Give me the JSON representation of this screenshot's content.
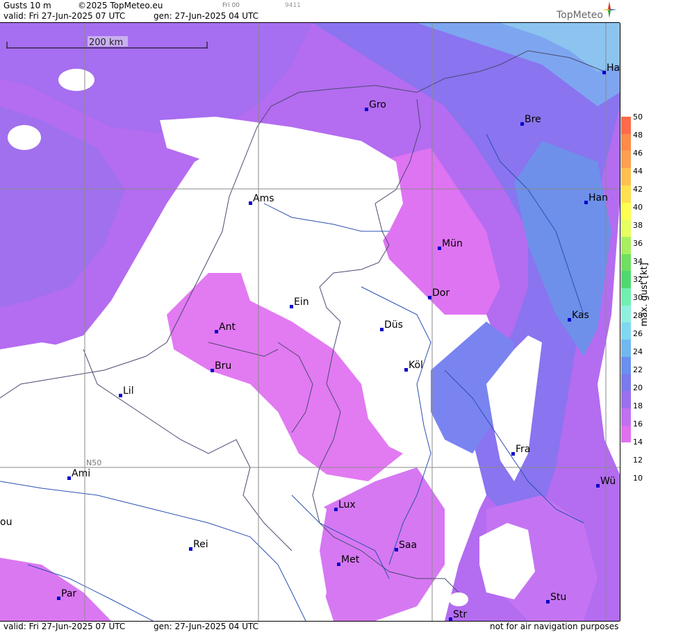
{
  "header": {
    "product": "Gusts 10 m",
    "copyright": "©2025 TopMeteo.eu",
    "frame_label": "Fri 00",
    "frame_code": "9411",
    "valid": "valid:  Fri  27-Jun-2025  07 UTC",
    "gen": "gen:  27-Jun-2025  04 UTC",
    "brand": "TopMeteo"
  },
  "footer": {
    "valid": "valid:  Fri  27-Jun-2025  07 UTC",
    "gen": "gen:  27-Jun-2025  04 UTC",
    "disclaimer": "not for air navigation purposes"
  },
  "scale_bar": {
    "label": "200 km"
  },
  "grid_label": "N50",
  "cities": [
    {
      "name": "Gro"
    },
    {
      "name": "Bre"
    },
    {
      "name": "Ha"
    },
    {
      "name": "Ams"
    },
    {
      "name": "Han"
    },
    {
      "name": "Mün"
    },
    {
      "name": "Dor"
    },
    {
      "name": "Ein"
    },
    {
      "name": "Kas"
    },
    {
      "name": "Ant"
    },
    {
      "name": "Düs"
    },
    {
      "name": "Köl"
    },
    {
      "name": "Bru"
    },
    {
      "name": "Lil"
    },
    {
      "name": "Fra"
    },
    {
      "name": "Ami"
    },
    {
      "name": "Wü"
    },
    {
      "name": "Lux"
    },
    {
      "name": "ou"
    },
    {
      "name": "Rei"
    },
    {
      "name": "Saa"
    },
    {
      "name": "Met"
    },
    {
      "name": "Par"
    },
    {
      "name": "Stu"
    },
    {
      "name": "Str"
    }
  ],
  "legend": {
    "title": "max. gust [kt]",
    "ticks": [
      "50",
      "48",
      "46",
      "44",
      "42",
      "40",
      "38",
      "36",
      "34",
      "32",
      "30",
      "28",
      "26",
      "24",
      "22",
      "20",
      "18",
      "16",
      "14",
      "12",
      "10"
    ],
    "colors": [
      "#ff6a4a",
      "#ff8a4a",
      "#ffa050",
      "#ffc050",
      "#ffe050",
      "#ffff50",
      "#e8ff60",
      "#a8f060",
      "#70e060",
      "#50d870",
      "#70f0b0",
      "#90f0e0",
      "#80d8f0",
      "#70b8f0",
      "#6a90f0",
      "#7a7af0",
      "#9a70f0",
      "#c070f0",
      "#e070f0",
      "#ffffff"
    ]
  }
}
